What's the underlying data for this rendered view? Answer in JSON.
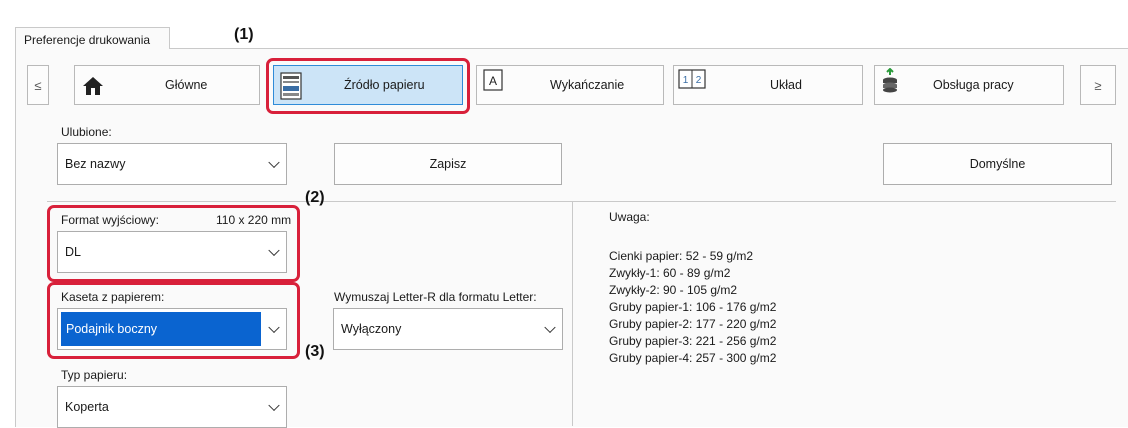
{
  "window": {
    "tab_label": "Preferencje drukowania"
  },
  "nav": {
    "prev_label": "≤",
    "next_label": "≥",
    "buttons": [
      {
        "label": "Główne",
        "icon": "home-icon"
      },
      {
        "label": "Źródło papieru",
        "icon": "paper-source-icon",
        "active": true
      },
      {
        "label": "Wykańczanie",
        "icon": "finishing-icon"
      },
      {
        "label": "Układ",
        "icon": "layout-icon"
      },
      {
        "label": "Obsługa pracy",
        "icon": "job-handling-icon"
      }
    ]
  },
  "favorites": {
    "label": "Ulubione:",
    "value": "Bez nazwy",
    "save_label": "Zapisz",
    "defaults_label": "Domyślne"
  },
  "output_format": {
    "label": "Format wyjściowy:",
    "size": "110 x 220 mm",
    "value": "DL"
  },
  "paper_tray": {
    "label": "Kaseta z papierem:",
    "value": "Podajnik boczny"
  },
  "paper_type": {
    "label": "Typ papieru:",
    "value": "Koperta"
  },
  "force_letter": {
    "label": "Wymuszaj Letter-R dla formatu Letter:",
    "value": "Wyłączony"
  },
  "note": {
    "title": "Uwaga:",
    "lines": [
      "Cienki papier: 52 - 59 g/m2",
      "Zwykły-1: 60 - 89 g/m2",
      "Zwykły-2: 90 - 105 g/m2",
      "Gruby papier-1: 106 - 176 g/m2",
      "Gruby papier-2: 177 - 220 g/m2",
      "Gruby papier-3: 221 - 256 g/m2",
      "Gruby papier-4: 257 - 300 g/m2"
    ]
  },
  "callouts": {
    "c1": "(1)",
    "c2": "(2)",
    "c3": "(3)"
  },
  "colors": {
    "highlight": "#d8203a",
    "selection": "#0a64d0",
    "active_tab": "#cce4f7"
  }
}
